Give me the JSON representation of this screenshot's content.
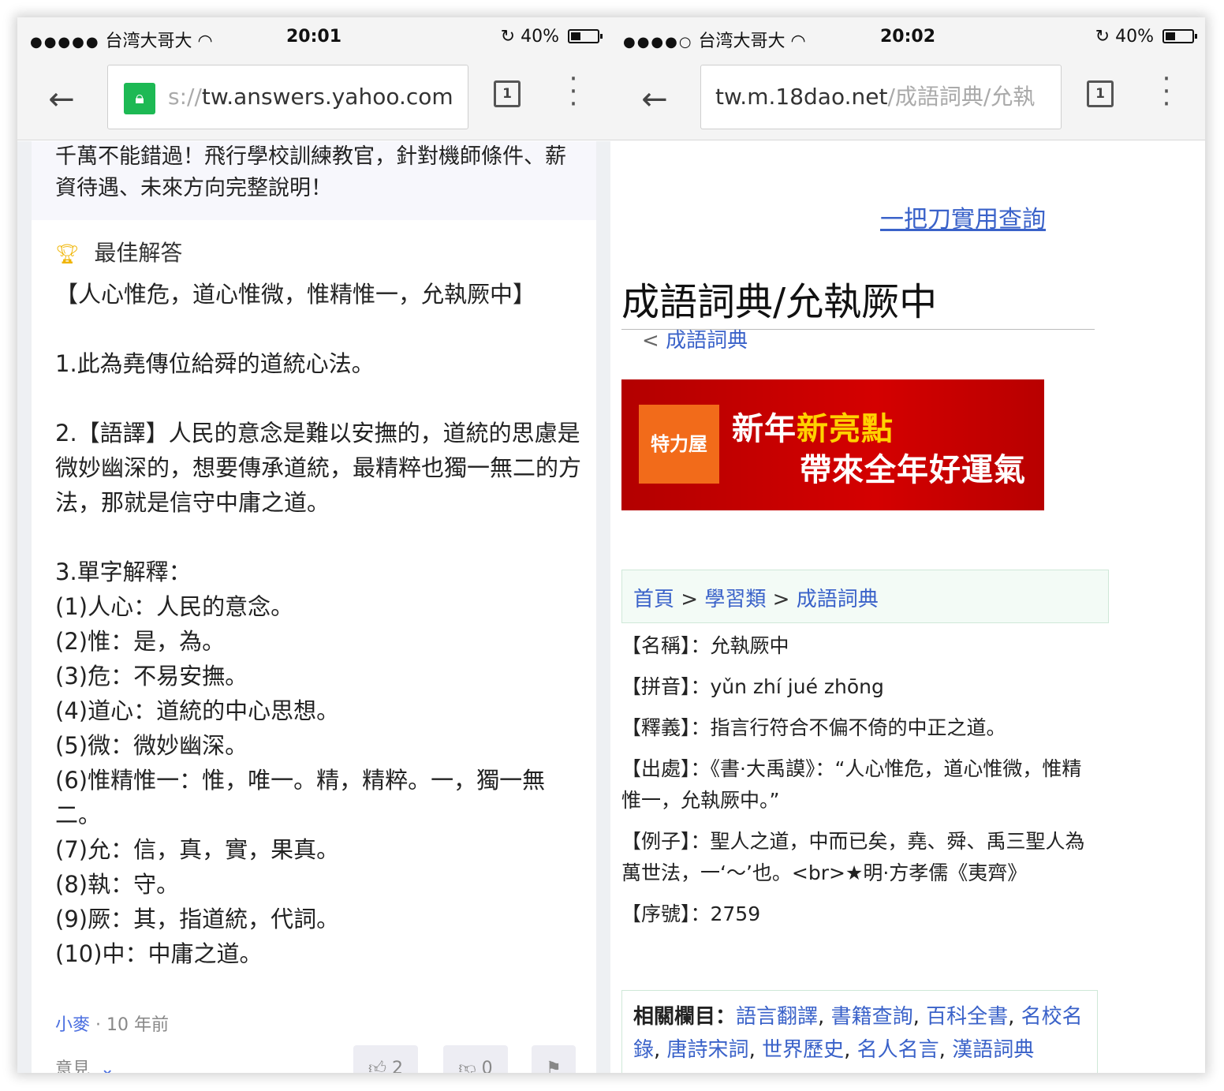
{
  "left": {
    "status": {
      "signal": "●●●●●",
      "carrier": "台湾大哥大",
      "time": "20:01",
      "battery": "40%"
    },
    "url": {
      "dim": "s://",
      "main": "tw.answers.yahoo.com"
    },
    "tabs_count": "1",
    "promo_text": "千萬不能錯過！飛行學校訓練教官，針對機師條件、薪資待遇、未來方向完整說明！",
    "best_answer_label": "最佳解答",
    "answer_lines": [
      "【人心惟危，道心惟微，惟精惟一，允執厥中】",
      "",
      "1.此為堯傳位給舜的道統心法。",
      "",
      "2.【語譯】人民的意念是難以安撫的，道統的思慮是微妙幽深的，想要傳承道統，最精粹也獨一無二的方法，那就是信守中庸之道。",
      "",
      "3.單字解釋：",
      "(1)人心：人民的意念。",
      "(2)惟：是，為。",
      "(3)危：不易安撫。",
      "(4)道心：道統的中心思想。",
      "(5)微：微妙幽深。",
      "(6)惟精惟一：惟，唯一。精，精粹。一，獨一無二。",
      "(7)允：信，真，實，果真。",
      "(8)執：守。",
      "(9)厥：其，指道統，代詞。",
      "(10)中：中庸之道。"
    ],
    "author": "小麥",
    "author_time": "· 10 年前",
    "opinion_label": "意見",
    "likes": "2",
    "dislikes": "0"
  },
  "right": {
    "status": {
      "signal": "●●●●○",
      "carrier": "台湾大哥大",
      "time": "20:02",
      "battery": "40%"
    },
    "url": {
      "main": "tw.m.18dao.net",
      "dim": "/成語詞典/允執"
    },
    "tabs_count": "1",
    "top_link": "一把刀實用查詢",
    "title": "成語詞典/允執厥中",
    "back_link_prefix": "< ",
    "back_link": "成語詞典",
    "banner": {
      "logo": "特力屋",
      "line1_a": "新年",
      "line1_b": "新亮點",
      "line2": "帶來全年好運氣"
    },
    "breadcrumb": [
      "首頁",
      "學習類",
      "成語詞典"
    ],
    "breadcrumb_sep": ">",
    "info": [
      "【名稱】：允執厥中",
      "【拼音】：yǔn zhí jué zhōng",
      "【釋義】：指言行符合不偏不倚的中正之道。",
      "【出處】：《書·大禹謨》：“人心惟危，道心惟微，惟精惟一，允執厥中。”",
      "【例子】：聖人之道，中而已矣，堯、舜、禹三聖人為萬世法，一‘～’也。<br>★明·方孝儒《夷齊》",
      "【序號】：2759"
    ],
    "related_label": "相關欄目：",
    "related_links": [
      "語言翻譯",
      "書籍查詢",
      "百科全書",
      "名校名錄",
      "唐詩宋詞",
      "世界歷史",
      "名人名言",
      "漢語詞典"
    ]
  }
}
